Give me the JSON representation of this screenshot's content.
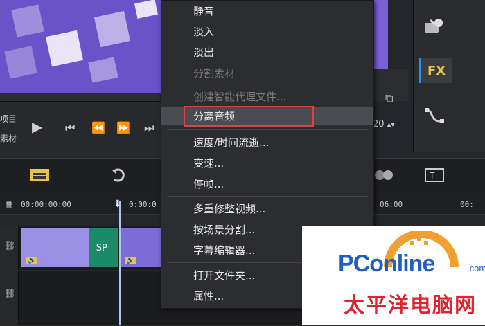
{
  "context_menu": {
    "items": [
      {
        "label": "静音",
        "enabled": true
      },
      {
        "label": "淡入",
        "enabled": true
      },
      {
        "label": "淡出",
        "enabled": true
      },
      {
        "label": "分割素材",
        "enabled": false
      },
      {
        "label": "创建智能代理文件...",
        "enabled": false
      },
      {
        "label": "分离音频",
        "enabled": true,
        "highlighted": true
      },
      {
        "label": "速度/时间流逝...",
        "enabled": true
      },
      {
        "label": "变速...",
        "enabled": true
      },
      {
        "label": "停帧...",
        "enabled": true
      },
      {
        "label": "多重修整视频...",
        "enabled": true
      },
      {
        "label": "按场景分割...",
        "enabled": true
      },
      {
        "label": "字幕编辑器...",
        "enabled": true
      },
      {
        "label": "打开文件夹...",
        "enabled": true
      },
      {
        "label": "属性...",
        "enabled": true
      }
    ]
  },
  "transport": {
    "label_project": "项目",
    "label_clip": "素材",
    "timecode_fragment": "20"
  },
  "side_panel": {
    "fx_label": "FX"
  },
  "timeline": {
    "ruler_start": "00:00:00:00",
    "ruler_partial": "0:00:0",
    "ruler_right_1": "06:00",
    "ruler_right_2": "00:"
  },
  "clip": {
    "transition_label": "SP-"
  },
  "watermark": {
    "brand": "PConline",
    "domain_suffix": ".com",
    "chinese": "太平洋电脑网"
  },
  "colors": {
    "accent_blue": "#2f8fe8",
    "highlight_red": "#e04040",
    "fx_yellow": "#e8c348",
    "transition_green": "#1b8a67"
  }
}
